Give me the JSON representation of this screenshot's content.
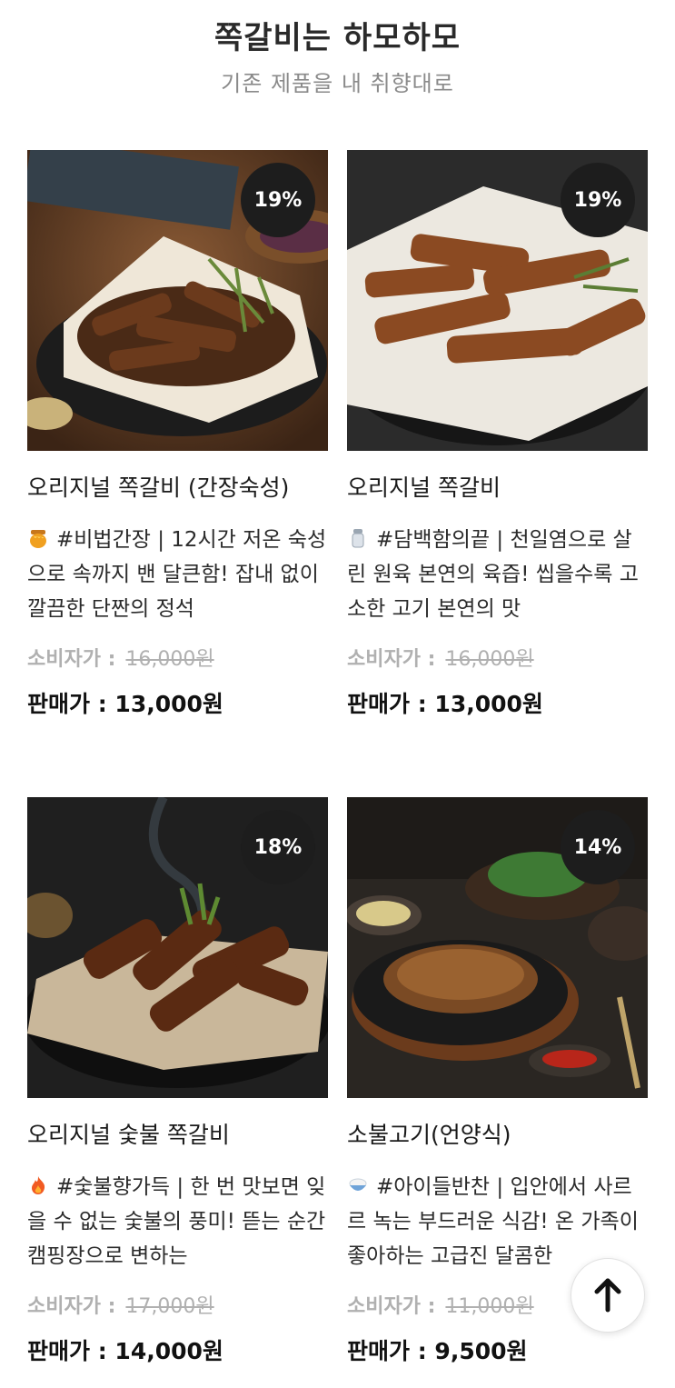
{
  "header": {
    "title": "쪽갈비는 하모하모",
    "subtitle": "기존 제품을 내 취향대로"
  },
  "products": [
    {
      "badge": "19%",
      "name": "오리지널 쪽갈비 (간장숙성)",
      "emoji": "honey-pot-icon",
      "desc": "#비법간장 | 12시간 저온 숙성으로 속까지 밴 달큰함! 잡내 없이 깔끔한 단짠의 정석",
      "consumer_label": "소비자가 :",
      "consumer_price": "16,000원",
      "sale_label": "판매가 :",
      "sale_price": "13,000원"
    },
    {
      "badge": "19%",
      "name": "오리지널 쪽갈비",
      "emoji": "salt-shaker-icon",
      "desc": "#담백함의끝 | 천일염으로 살린 원육 본연의 육즙! 씹을수록 고소한 고기 본연의 맛",
      "consumer_label": "소비자가 :",
      "consumer_price": "16,000원",
      "sale_label": "판매가 :",
      "sale_price": "13,000원"
    },
    {
      "badge": "18%",
      "name": "오리지널 숯불 쪽갈비",
      "emoji": "fire-icon",
      "desc": "#숯불향가득 | 한 번 맛보면 잊을 수 없는 숯불의 풍미! 뜯는 순간 캠핑장으로 변하는",
      "consumer_label": "소비자가 :",
      "consumer_price": "17,000원",
      "sale_label": "판매가 :",
      "sale_price": "14,000원"
    },
    {
      "badge": "14%",
      "name": "소불고기(언양식)",
      "emoji": "rice-bowl-icon",
      "desc": "#아이들반찬 | 입안에서 사르르 녹는 부드러운 식감! 온 가족이 좋아하는 고급진 달콤한",
      "consumer_label": "소비자가 :",
      "consumer_price": "11,000원",
      "sale_label": "판매가 :",
      "sale_price": "9,500원"
    }
  ],
  "scroll_top": {
    "icon": "arrow-up-icon"
  }
}
